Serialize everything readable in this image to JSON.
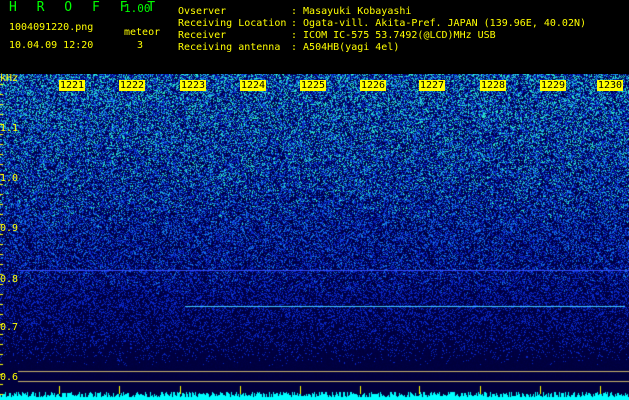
{
  "app": {
    "title": "H R O F F T",
    "version": "1.00"
  },
  "file": {
    "name": "1004091220.png",
    "datetime": "10.04.09 12:20",
    "meteor_label": "meteor",
    "meteor_count": "3"
  },
  "info": {
    "observer_label": "Ovserver",
    "observer_value": ": Masayuki Kobayashi",
    "location_label": "Receiving Location",
    "location_value": ": Ogata-vill. Akita-Pref. JAPAN (139.96E, 40.02N)",
    "receiver_label": "Receiver",
    "receiver_value": ": ICOM IC-575 53.7492(@LCD)MHz USB",
    "antenna_label": "Receiving antenna",
    "antenna_value": ": A504HB(yagi 4el)"
  },
  "axis": {
    "unit": "kHz",
    "freq_ticks": [
      "1.1",
      "1.0",
      "0.9",
      "0.8",
      "0.7",
      "0.6"
    ],
    "time_ticks": [
      "1221",
      "1222",
      "1223",
      "1224",
      "1225",
      "1226",
      "1227",
      "1228",
      "1229",
      "1230"
    ]
  },
  "colors": {
    "title": "#00ff00",
    "meta_yellow": "#ffff00",
    "background": "#000000",
    "signal_cyan": "#00ffff"
  }
}
